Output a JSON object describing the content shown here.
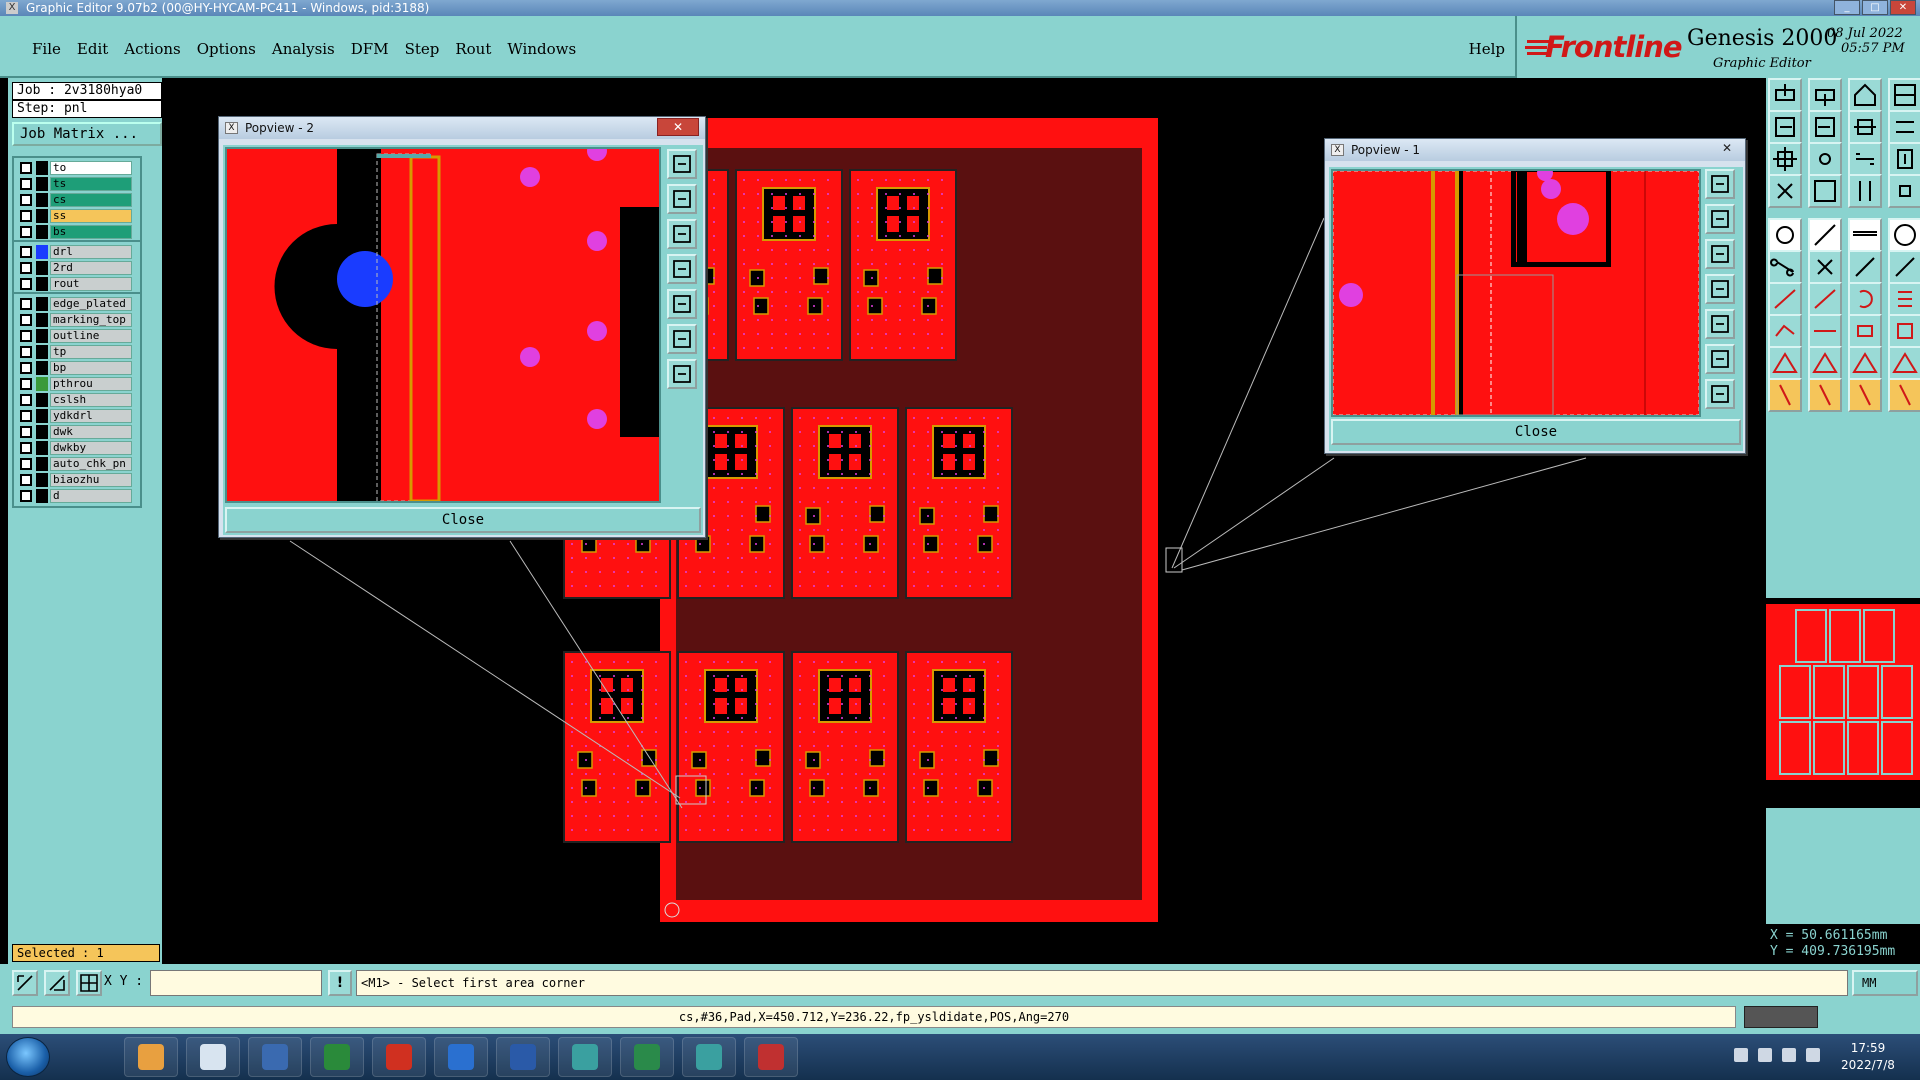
{
  "window": {
    "title": "Graphic Editor 9.07b2 (00@HY-HYCAM-PC411 - Windows, pid:3188)"
  },
  "menubar": {
    "items": [
      "File",
      "Edit",
      "Actions",
      "Options",
      "Analysis",
      "DFM",
      "Step",
      "Rout",
      "Windows"
    ],
    "help": "Help"
  },
  "brand": {
    "logo": "Frontline",
    "product": "Genesis 2000",
    "subtitle": "Graphic Editor",
    "date": "08 Jul 2022",
    "time": "05:57 PM"
  },
  "left_panel": {
    "job": "Job : 2v3180hya0",
    "step": "Step: pnl",
    "job_matrix": "Job Matrix ...",
    "group1": [
      {
        "name": "to",
        "color": "#ffffff"
      },
      {
        "name": "ts",
        "color": "#1e9e78"
      },
      {
        "name": "cs",
        "color": "#1e9e78"
      },
      {
        "name": "ss",
        "color": "#f5c55a"
      },
      {
        "name": "bs",
        "color": "#1e9e78"
      }
    ],
    "group2": [
      {
        "name": "drl",
        "color": "#c9cfcf"
      },
      {
        "name": "2rd",
        "color": "#c9cfcf"
      },
      {
        "name": "rout",
        "color": "#c9cfcf"
      }
    ],
    "group3": [
      {
        "name": "edge_plated",
        "color": "#c9cfcf"
      },
      {
        "name": "marking_top",
        "color": "#c9cfcf"
      },
      {
        "name": "outline",
        "color": "#c9cfcf"
      },
      {
        "name": "tp",
        "color": "#c9cfcf"
      },
      {
        "name": "bp",
        "color": "#c9cfcf"
      },
      {
        "name": "pthrou",
        "color": "#c9cfcf"
      },
      {
        "name": "cslsh",
        "color": "#c9cfcf"
      },
      {
        "name": "ydkdrl",
        "color": "#c9cfcf"
      },
      {
        "name": "dwk",
        "color": "#c9cfcf"
      },
      {
        "name": "dwkby",
        "color": "#c9cfcf"
      },
      {
        "name": "auto_chk_pn",
        "color": "#c9cfcf"
      },
      {
        "name": "biaozhu",
        "color": "#c9cfcf"
      },
      {
        "name": "d",
        "color": "#c9cfcf"
      }
    ],
    "selected": "Selected : 1"
  },
  "popview2": {
    "title": "Popview - 2",
    "close": "Close"
  },
  "popview1": {
    "title": "Popview - 1",
    "close": "Close"
  },
  "coords": {
    "x": "X =  50.661165mm",
    "y": "Y = 409.736195mm"
  },
  "command_bar": {
    "xy_label": "X Y :",
    "xy_value": "",
    "warn": "!",
    "prompt": "<M1> - Select first area corner",
    "units": "MM"
  },
  "status_line": {
    "text": "cs,#36,Pad,X=450.712,Y=236.22,fp_ysldidate,POS,Ang=270"
  },
  "taskbar": {
    "time": "17:59",
    "date": "2022/7/8"
  },
  "colors": {
    "panel": "#8ad3cf",
    "copper": "#ff1010",
    "pad": "#e040e0",
    "drill": "#1a3cff"
  }
}
